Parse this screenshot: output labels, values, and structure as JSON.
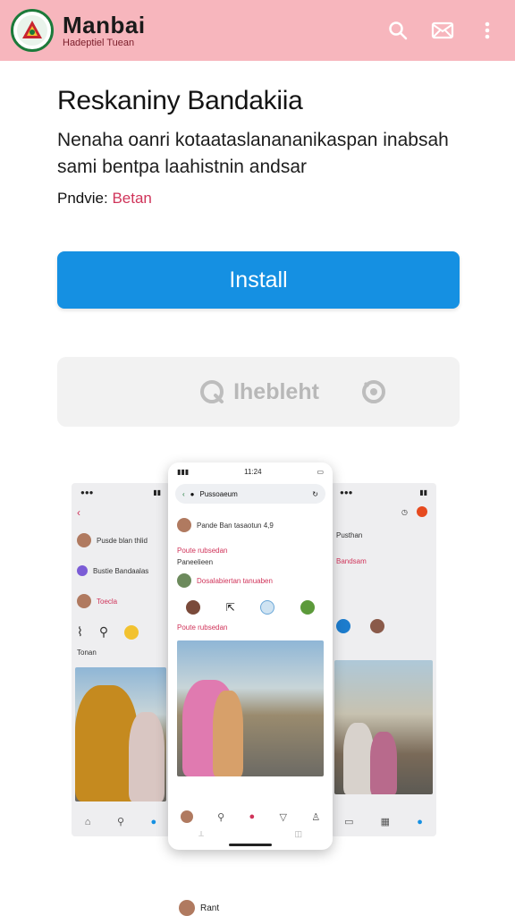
{
  "header": {
    "brand_name": "Manbai",
    "brand_sub": "Hadeptiel Tuean",
    "actions": [
      "search-icon",
      "mail-icon",
      "more-vert-icon"
    ],
    "color": "#f7b6bd"
  },
  "app": {
    "title": "Reskaniny Bandakiia",
    "description": "Nenaha oanri kotaataslanananikaspan inabsah sami bentpa laahistnin andsar",
    "provider_label": "Pndvie:",
    "provider_value": "Betan"
  },
  "buttons": {
    "install_label": "Install",
    "install_color": "#1590e2",
    "secondary_label": "Ihebleht"
  },
  "screenshots": {
    "center": {
      "time": "11:24",
      "url": "Pussoaeum",
      "post_title": "Pande Ban tasaotun 4,9",
      "post_meta": "Poute rubsedan",
      "comment_author": "Paneelieen",
      "comment_text": "Dosalabiertan tanuaben"
    },
    "left": {
      "row1": "Pusde blan thlid",
      "row2": "Bustie Bandaalas",
      "row3": "Toecla",
      "section": "Tonan"
    },
    "right": {
      "row1": "Pusthan",
      "row2": "Bandsam"
    }
  },
  "footer": {
    "label": "Rant"
  }
}
